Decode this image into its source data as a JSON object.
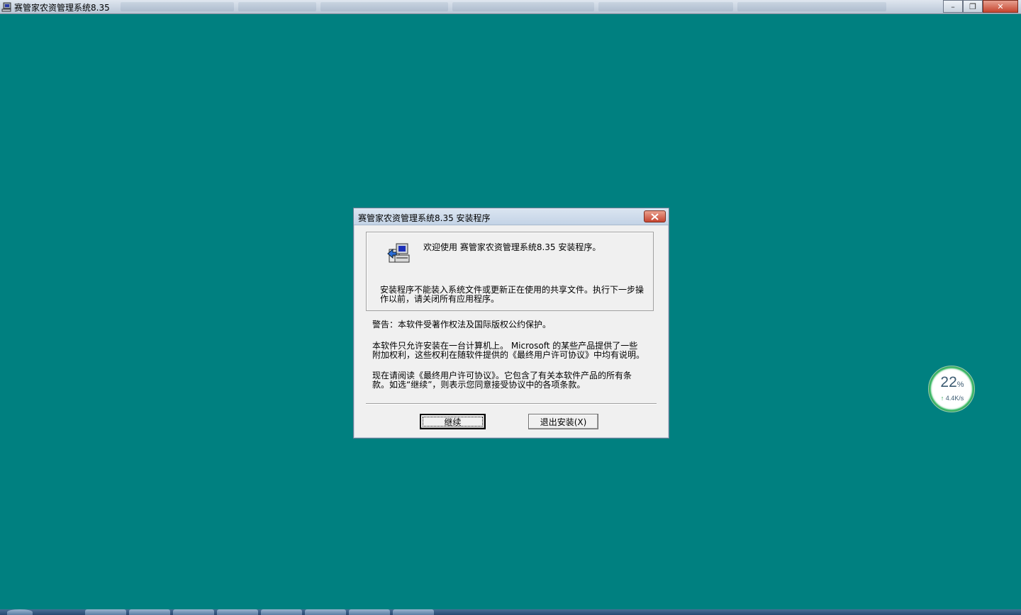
{
  "window": {
    "title": "赛管家农资管理系统8.35",
    "minimize_glyph": "–",
    "restore_glyph": "❐",
    "close_glyph": "✕"
  },
  "dialog": {
    "title": "赛管家农资管理系统8.35 安装程序",
    "close_glyph": "✕",
    "welcome": "欢迎使用 赛管家农资管理系统8.35 安装程序。",
    "warning_line1": "安装程序不能装入系统文件或更新正在使用的共享文件。执行下一步操",
    "warning_line2": "作以前，请关闭所有应用程序。",
    "para1": "警告：本软件受著作权法及国际版权公约保护。",
    "para2_line1": "本软件只允许安装在一台计算机上。 Microsoft 的某些产品提供了一些",
    "para2_line2": "附加权利，这些权利在随软件提供的《最终用户许可协议》中均有说明。",
    "para3_line1": "现在请阅读《最终用户许可协议》。它包含了有关本软件产品的所有条",
    "para3_line2": "款。如选“继续”，则表示您同意接受协议中的各项条款。",
    "continue_label": "继续",
    "exit_label": "退出安装(X)"
  },
  "net_widget": {
    "percent": "22",
    "percent_sign": "%",
    "speed": "4.4K/s",
    "upload_arrow": "↑"
  },
  "icons": {
    "app": "setup-computer-icon",
    "dialog_close": "close-icon"
  },
  "colors": {
    "desktop": "#008080",
    "dialog_bg": "#f0f0f0",
    "close_red": "#c64531",
    "widget_green": "#2fa55a"
  }
}
